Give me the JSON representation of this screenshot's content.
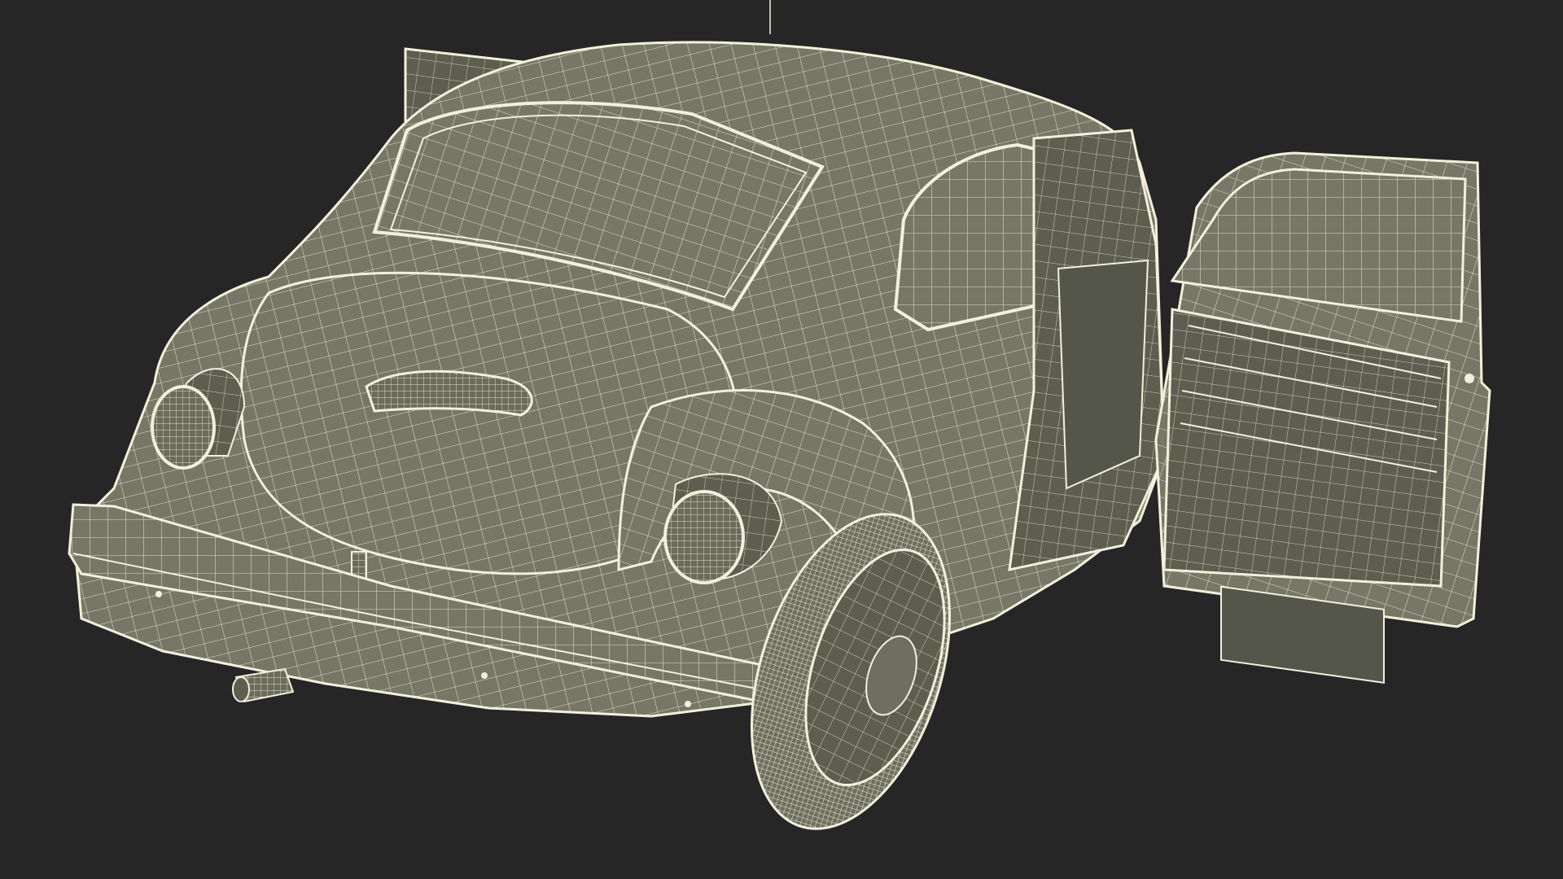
{
  "scene": {
    "subject": "beetle-car-wireframe",
    "background_color": "#262626",
    "surface_color": "#767766",
    "surface_dark_color": "#5d5e50",
    "wire_color": "#f2f0dc",
    "shadow_color": "#4a4b40"
  }
}
